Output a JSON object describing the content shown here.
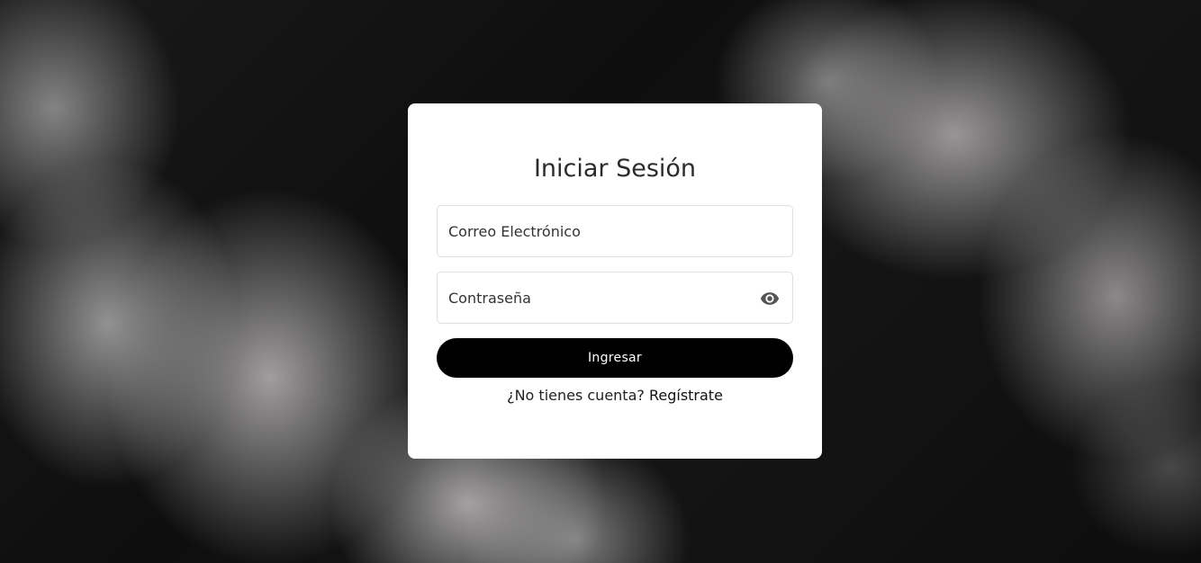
{
  "login": {
    "title": "Iniciar Sesión",
    "email_placeholder": "Correo Electrónico",
    "password_placeholder": "Contraseña",
    "password_toggle_icon": "eye-icon",
    "submit_label": "Ingresar",
    "signup_prompt": "¿No tienes cuenta?",
    "signup_link": "Regístrate"
  },
  "colors": {
    "card_background": "#ffffff",
    "button_background": "#000000",
    "button_text": "#ffffff",
    "page_background": "#141414"
  }
}
